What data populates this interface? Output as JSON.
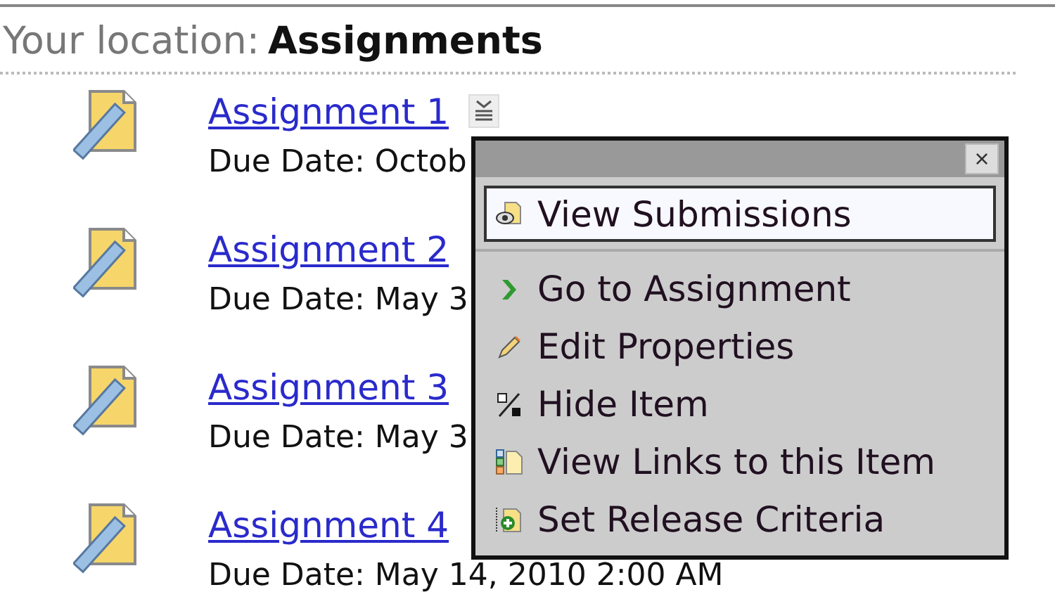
{
  "breadcrumb": {
    "label": "Your location:",
    "current": "Assignments"
  },
  "assignments": [
    {
      "title": "Assignment 1",
      "due": "Due Date: Octob",
      "menu_button": true
    },
    {
      "title": "Assignment 2",
      "due": "Due Date: May 3",
      "menu_button": false
    },
    {
      "title": "Assignment 3",
      "due": "Due Date: May 3",
      "menu_button": false
    },
    {
      "title": "Assignment 4",
      "due": "Due Date: May 14, 2010 2:00 AM",
      "menu_button": false
    }
  ],
  "context_menu": {
    "close": "×",
    "items": [
      {
        "label": "View Submissions",
        "kind": "submissions",
        "selected": true
      },
      {
        "label": "Go to Assignment",
        "kind": "go",
        "selected": false
      },
      {
        "label": "Edit Properties",
        "kind": "edit",
        "selected": false
      },
      {
        "label": "Hide Item",
        "kind": "hide",
        "selected": false
      },
      {
        "label": "View Links to this Item",
        "kind": "links",
        "selected": false
      },
      {
        "label": "Set Release Criteria",
        "kind": "release",
        "selected": false
      }
    ]
  }
}
